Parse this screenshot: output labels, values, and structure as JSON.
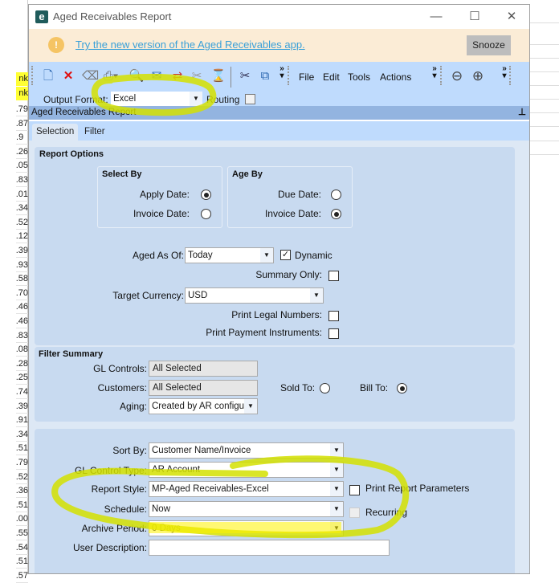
{
  "background_sheet": {
    "highlighted_cells": [
      "nk",
      "nk"
    ],
    "cells": [
      "79.",
      "87.",
      "9.",
      "26.",
      "05.",
      "83.",
      "01.",
      "34.",
      "52.",
      "12.",
      "39.",
      "93.",
      "58.",
      "70.",
      "46.",
      "46.",
      "83.",
      "08.",
      "28.",
      "25.",
      "74.",
      "39.",
      "91.",
      "34.",
      "51.",
      "79.",
      "52.",
      "36.",
      "51.",
      "00.",
      "55.",
      "54.",
      "51.",
      "57."
    ]
  },
  "window": {
    "title": "Aged Receivables Report",
    "minimize": "—",
    "maximize": "☐",
    "close": "✕"
  },
  "banner": {
    "link": "Try the new version of the Aged Receivables app.",
    "snooze": "Snooze"
  },
  "toolbar": {
    "menus": [
      "File",
      "Edit",
      "Tools",
      "Actions"
    ],
    "output_format_label": "Output Format:",
    "output_format_value": "Excel",
    "routing_label": "Routing"
  },
  "section_header": "Aged Receivables Report",
  "tabs": [
    "Selection",
    "Filter"
  ],
  "report_options": {
    "title": "Report Options",
    "select_by": {
      "title": "Select By",
      "apply_date": "Apply Date:",
      "invoice_date": "Invoice Date:",
      "selected": "apply_date"
    },
    "age_by": {
      "title": "Age By",
      "due_date": "Due Date:",
      "invoice_date": "Invoice Date:",
      "selected": "invoice_date"
    },
    "aged_as_of_label": "Aged As Of:",
    "aged_as_of_value": "Today",
    "dynamic_label": "Dynamic",
    "dynamic_checked": true,
    "summary_only_label": "Summary Only:",
    "target_currency_label": "Target Currency:",
    "target_currency_value": "USD",
    "print_legal_numbers_label": "Print Legal Numbers:",
    "print_payment_instruments_label": "Print Payment Instruments:"
  },
  "filter_summary": {
    "title": "Filter Summary",
    "gl_controls_label": "GL Controls:",
    "gl_controls_value": "All Selected",
    "customers_label": "Customers:",
    "customers_value": "All Selected",
    "sold_to_label": "Sold To:",
    "bill_to_label": "Bill To:",
    "selected": "bill_to",
    "aging_label": "Aging:",
    "aging_value": "Created by AR configu"
  },
  "output_options": {
    "sort_by_label": "Sort By:",
    "sort_by_value": "Customer Name/Invoice",
    "gl_control_type_label": "GL Control Type:",
    "gl_control_type_value": "AR Account",
    "report_style_label": "Report Style:",
    "report_style_value": "MP-Aged Receivables-Excel",
    "print_report_parameters_label": "Print Report Parameters",
    "schedule_label": "Schedule:",
    "schedule_value": "Now",
    "recurring_label": "Recurring",
    "archive_period_label": "Archive Period:",
    "archive_period_value": "0 Days",
    "user_description_label": "User Description:",
    "user_description_value": ""
  },
  "colors": {
    "annotation": "#d4e000",
    "toolbar": "#bfdbfd",
    "panel": "#c8daf0"
  }
}
